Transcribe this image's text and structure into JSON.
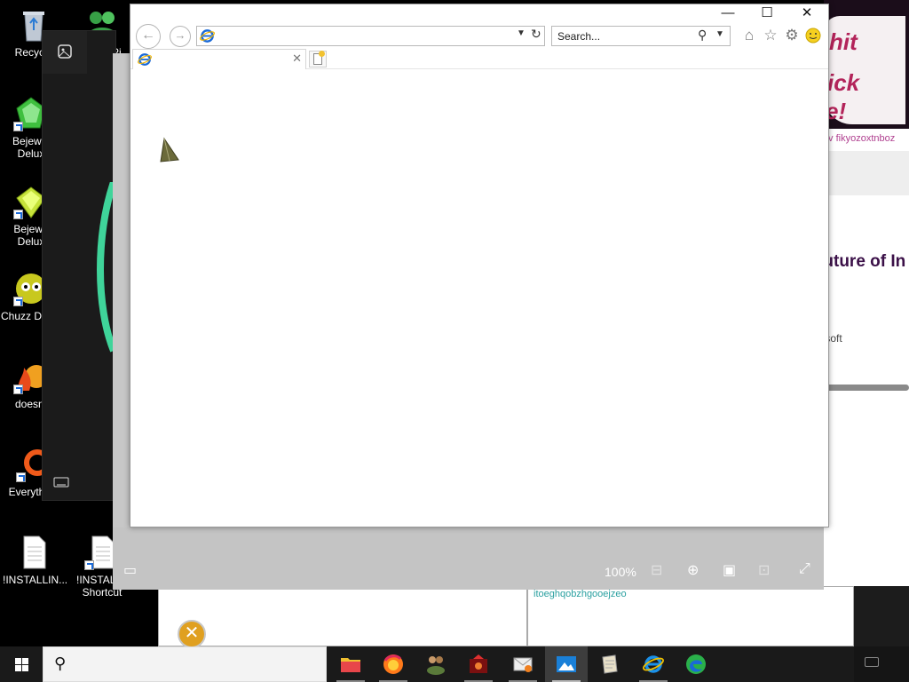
{
  "desktop": {
    "icons": [
      {
        "label": "Recycle"
      },
      {
        "label": "iPi"
      },
      {
        "label": "Bejewel Delux"
      },
      {
        "label": "Bejewe Delux"
      },
      {
        "label": "Chuzz Delux"
      },
      {
        "label": "doesnt"
      },
      {
        "label": "Everything"
      },
      {
        "label": "!INSTALLIN..."
      },
      {
        "label": "!INSTALL - Shortcut"
      }
    ]
  },
  "background": {
    "sticker_lines": [
      "hit",
      "ick",
      "e!"
    ],
    "sticker_url": "tv fikyozoxtnboz",
    "edge_card_title": "The future of In\nEdge.",
    "edge_card_brand": "Microsoft",
    "bottom_text": "itoeghqobzhgooejzeo"
  },
  "ie": {
    "search_placeholder": "Search...",
    "address_value": "",
    "tab_title": "",
    "window_controls": {
      "minimize": "—",
      "maximize": "☐",
      "close": "✕"
    }
  },
  "viewer": {
    "zoom": "100%"
  },
  "taskbar": {
    "search_placeholder": "",
    "apps": [
      {
        "name": "file-explorer"
      },
      {
        "name": "firefox"
      },
      {
        "name": "people-app"
      },
      {
        "name": "game-app"
      },
      {
        "name": "email-app"
      },
      {
        "name": "photos-app",
        "active": true
      },
      {
        "name": "notepad-app"
      },
      {
        "name": "internet-explorer"
      },
      {
        "name": "edge"
      }
    ]
  },
  "colors": {
    "accent_card_title": "#3b1048",
    "ie_blue": "#1a6ad8",
    "viewer_bar": "#c4c4c4",
    "taskbar": "#1a1a1a"
  }
}
